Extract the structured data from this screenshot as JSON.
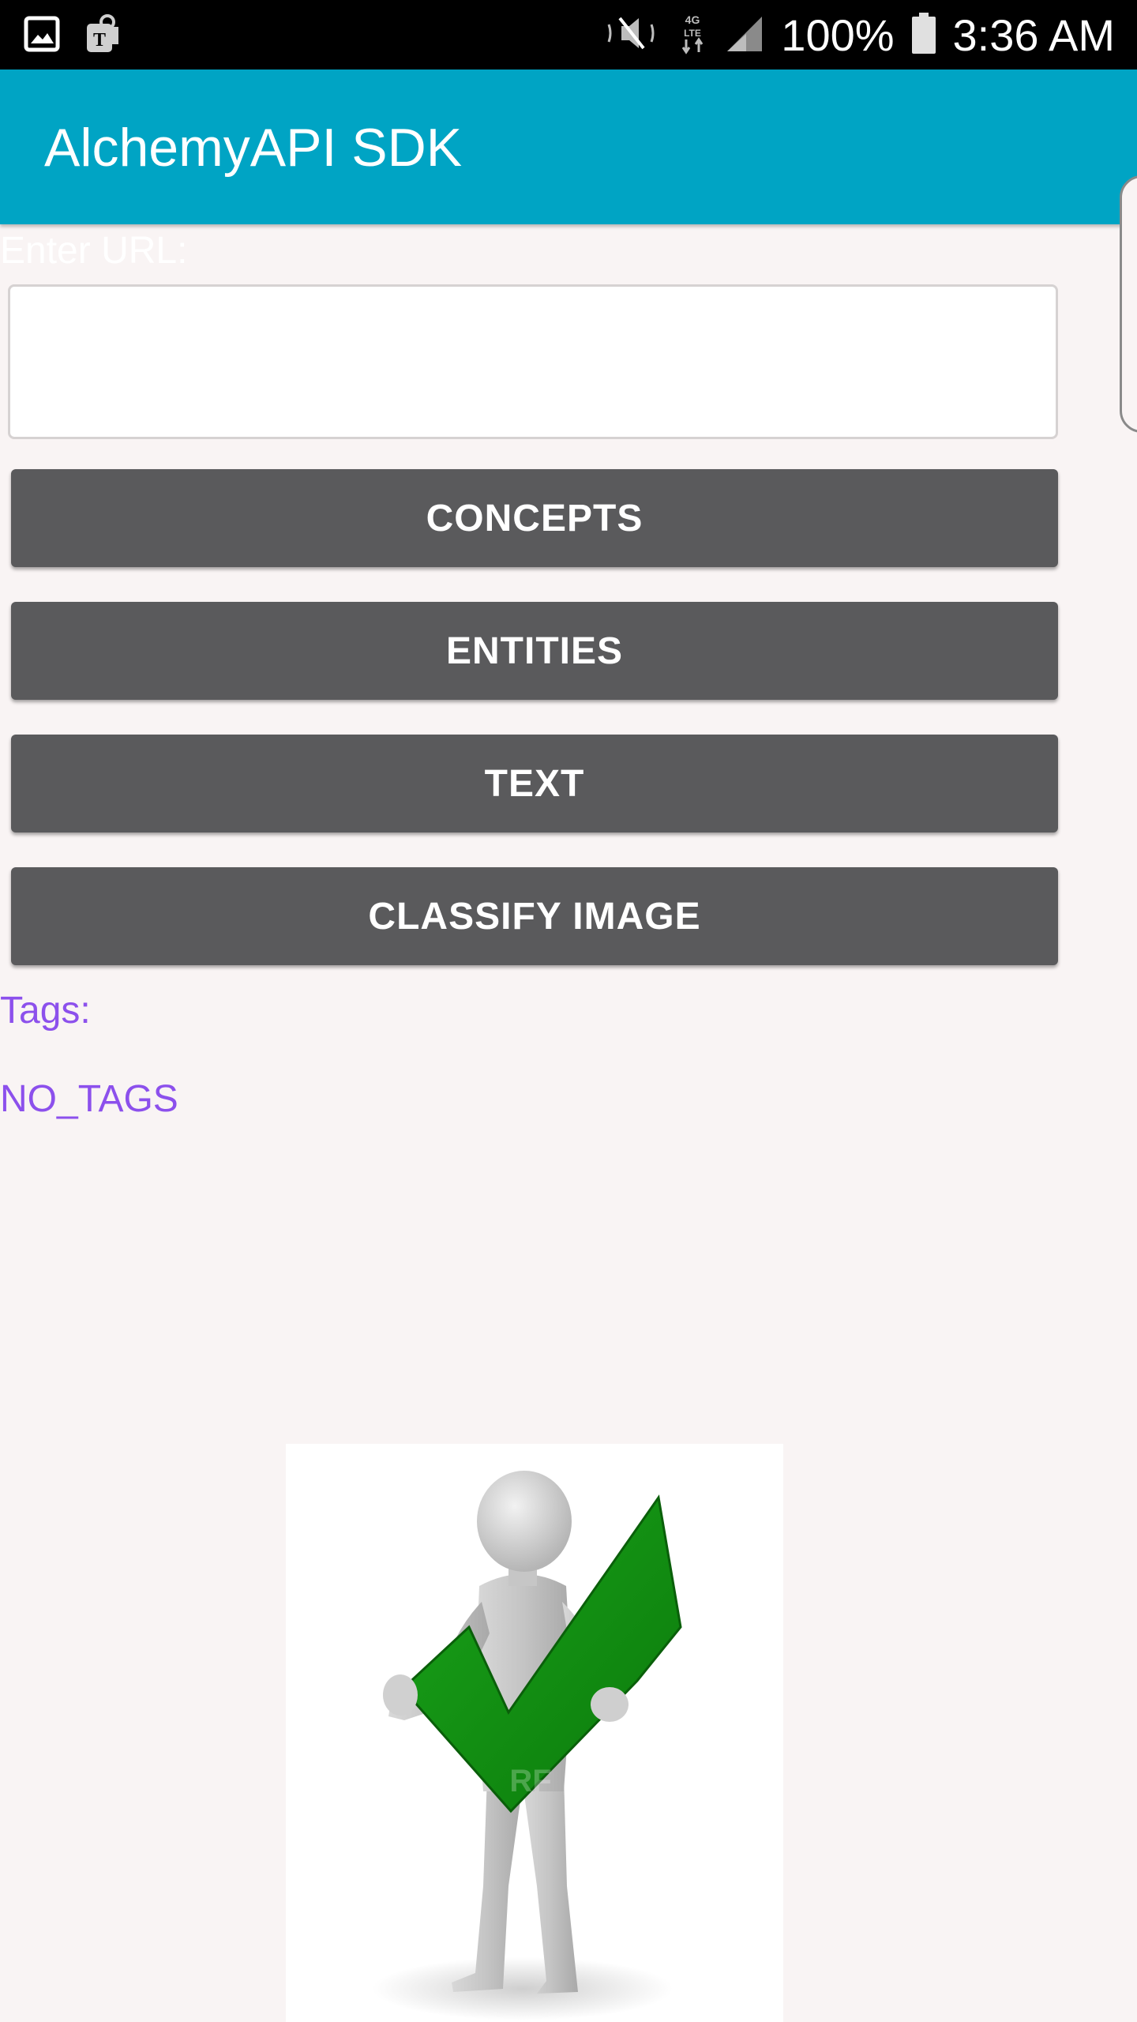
{
  "status_bar": {
    "battery": "100%",
    "time": "3:36 AM",
    "icons": [
      "gallery-icon",
      "tmobile-icon",
      "mute-icon",
      "4g-lte-icon",
      "signal-icon",
      "battery-icon"
    ]
  },
  "app_bar": {
    "title": "AlchemyAPI SDK",
    "color": "#00a4c4"
  },
  "form": {
    "url_label": "Enter URL:",
    "url_value": "",
    "buttons": {
      "concepts": "CONCEPTS",
      "entities": "ENTITIES",
      "text": "TEXT",
      "classify_image": "CLASSIFY IMAGE"
    },
    "button_color": "#5a5a5c"
  },
  "results": {
    "tags_label": "Tags:",
    "tags_value": "NO_TAGS",
    "text_color": "#8c50ec"
  },
  "image": {
    "icon": "person-with-checkmark-image"
  }
}
